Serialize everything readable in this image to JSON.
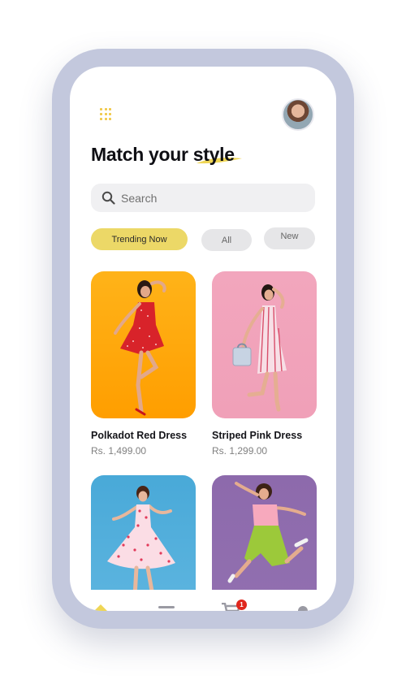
{
  "header": {
    "title": "Match your style",
    "accent_color": "#f0c94a"
  },
  "search": {
    "placeholder": "Search",
    "value": ""
  },
  "filters": [
    {
      "label": "Trending Now",
      "active": true
    },
    {
      "label": "All",
      "active": false
    },
    {
      "label": "New",
      "active": false
    }
  ],
  "products": [
    {
      "name": "Polkadot Red Dress",
      "price": "Rs.  1,499.00",
      "background": "#ffa80a"
    },
    {
      "name": "Striped Pink Dress",
      "price": "Rs.  1,299.00",
      "background": "#f2a6bd"
    },
    {
      "name": "",
      "price": "",
      "background": "#49a9d8"
    },
    {
      "name": "",
      "price": "",
      "background": "#8d6aac"
    }
  ],
  "nav": {
    "cart_badge": "1",
    "items": [
      "home-icon",
      "list-icon",
      "cart-icon",
      "profile-icon"
    ]
  }
}
